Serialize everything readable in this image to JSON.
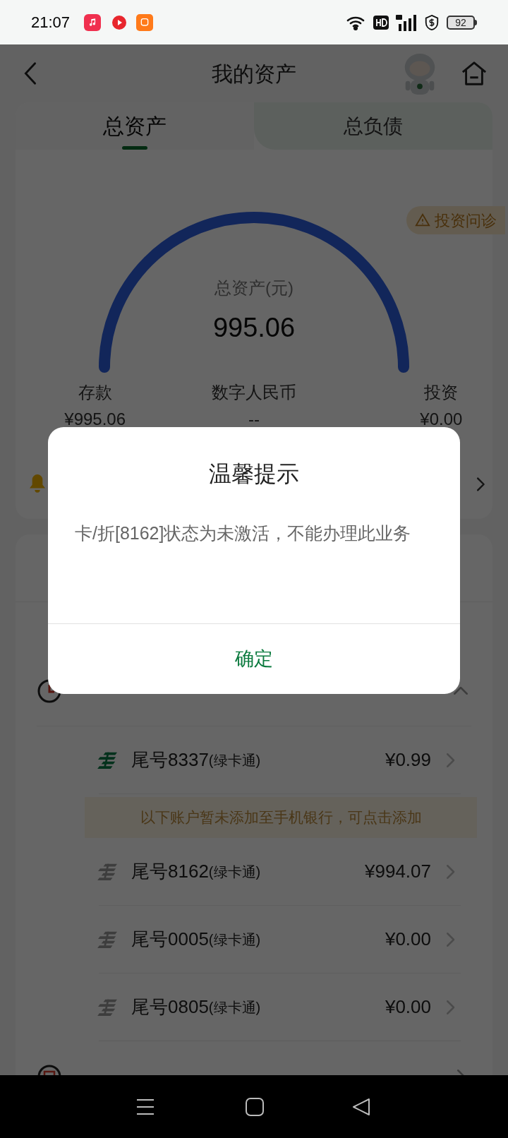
{
  "status_bar": {
    "time": "21:07",
    "battery": "92"
  },
  "header": {
    "title": "我的资产"
  },
  "tabs": [
    {
      "label": "总资产",
      "selected": true
    },
    {
      "label": "总负债",
      "selected": false
    }
  ],
  "consult_badge": "投资问诊",
  "summary": {
    "label": "总资产(元)",
    "value": "995.06"
  },
  "stats": [
    {
      "label": "存款",
      "value": "¥995.06"
    },
    {
      "label": "数字人民币",
      "value": "--"
    },
    {
      "label": "投资",
      "value": "¥0.00"
    }
  ],
  "current_deposit": {
    "expanded": true
  },
  "added_accounts": [
    {
      "number": "尾号8337",
      "type": "(绿卡通)",
      "amount": "¥0.99"
    }
  ],
  "notice": "以下账户暂未添加至手机银行，可点击添加",
  "unadded_accounts": [
    {
      "number": "尾号8162",
      "type": "(绿卡通)",
      "amount": "¥994.07"
    },
    {
      "number": "尾号0005",
      "type": "(绿卡通)",
      "amount": "¥0.00"
    },
    {
      "number": "尾号0805",
      "type": "(绿卡通)",
      "amount": "¥0.00"
    }
  ],
  "fixed_deposit": {
    "expanded": false
  },
  "dialog": {
    "title": "温馨提示",
    "message": "卡/折[8162]状态为未激活，不能办理此业务",
    "button": "确定"
  }
}
